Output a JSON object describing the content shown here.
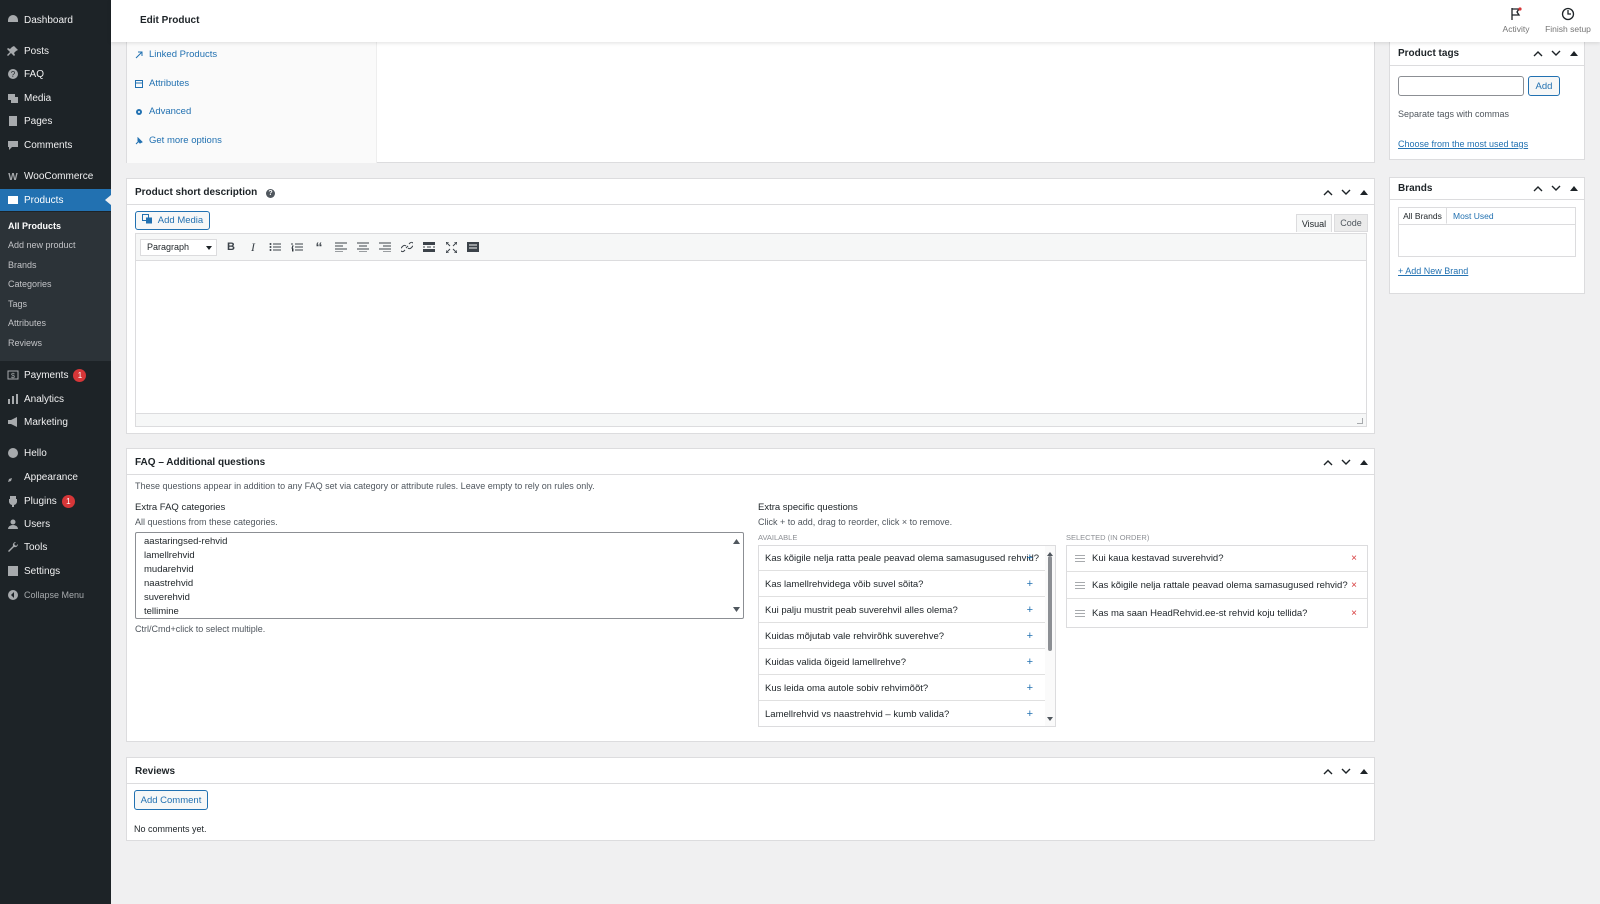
{
  "sidebar": {
    "menu": [
      {
        "label": "Dashboard",
        "icon": "dashboard-icon"
      },
      {
        "label": "Posts",
        "icon": "pin-icon"
      },
      {
        "label": "FAQ",
        "icon": "question-icon"
      },
      {
        "label": "Media",
        "icon": "media-icon"
      },
      {
        "label": "Pages",
        "icon": "page-icon"
      },
      {
        "label": "Comments",
        "icon": "comment-icon"
      },
      {
        "label": "WooCommerce",
        "icon": "woo-icon"
      },
      {
        "label": "Products",
        "icon": "archive-icon"
      },
      {
        "label": "Payments",
        "icon": "payments-icon",
        "badge": "1"
      },
      {
        "label": "Analytics",
        "icon": "bar-chart-icon"
      },
      {
        "label": "Marketing",
        "icon": "megaphone-icon"
      },
      {
        "label": "Hello",
        "icon": "plus-circle-icon"
      },
      {
        "label": "Appearance",
        "icon": "brush-icon"
      },
      {
        "label": "Plugins",
        "icon": "plug-icon",
        "badge": "1"
      },
      {
        "label": "Users",
        "icon": "users-icon"
      },
      {
        "label": "Tools",
        "icon": "wrench-icon"
      },
      {
        "label": "Settings",
        "icon": "settings-icon"
      },
      {
        "label": "Collapse Menu",
        "icon": "collapse-icon"
      }
    ],
    "submenu": [
      "All Products",
      "Add new product",
      "Brands",
      "Categories",
      "Tags",
      "Attributes",
      "Reviews"
    ]
  },
  "topbar": {
    "title": "Edit Product",
    "activity": "Activity",
    "finish_setup": "Finish setup"
  },
  "product_data": {
    "tabs": [
      "Linked Products",
      "Attributes",
      "Advanced",
      "Get more options"
    ]
  },
  "short_desc": {
    "title": "Product short description",
    "add_media": "Add Media",
    "visual": "Visual",
    "code": "Code",
    "format": "Paragraph"
  },
  "faq": {
    "title": "FAQ – Additional questions",
    "intro": "These questions appear in addition to any FAQ set via category or attribute rules. Leave empty to rely on rules only.",
    "cat_label": "Extra FAQ categories",
    "cat_hint": "All questions from these categories.",
    "categories": [
      "aastaringsed-rehvid",
      "lamellrehvid",
      "mudarehvid",
      "naastrehvid",
      "suverehvid",
      "tellimine"
    ],
    "cat_note": "Ctrl/Cmd+click to select multiple.",
    "spec_label": "Extra specific questions",
    "spec_hint": "Click + to add, drag to reorder, click × to remove.",
    "available_label": "AVAILABLE",
    "selected_label": "SELECTED (IN ORDER)",
    "available": [
      "Kas kõigile nelja ratta peale peavad olema samasugused rehvid?",
      "Kas lamellrehvidega võib suvel sõita?",
      "Kui palju mustrit peab suverehvil alles olema?",
      "Kuidas mõjutab vale rehvirõhk suverehve?",
      "Kuidas valida õigeid lamellrehve?",
      "Kus leida oma autole sobiv rehvimõõt?",
      "Lamellrehvid vs naastrehvid – kumb valida?"
    ],
    "selected": [
      "Kui kaua kestavad suverehvid?",
      "Kas kõigile nelja rattale peavad olema samasugused rehvid?",
      "Kas ma saan HeadRehvid.ee-st rehvid koju tellida?"
    ],
    "plus": "+",
    "remove": "×"
  },
  "reviews": {
    "title": "Reviews",
    "add_comment": "Add Comment",
    "empty": "No comments yet."
  },
  "tags": {
    "title": "Product tags",
    "add": "Add",
    "hint": "Separate tags with commas",
    "choose": "Choose from the most used tags",
    "input_value": ""
  },
  "brands": {
    "title": "Brands",
    "tab_all": "All Brands",
    "tab_most": "Most Used",
    "add_new": "+ Add New Brand"
  },
  "colors": {
    "accent": "#2271b1",
    "sidebar": "#1d2327",
    "badge": "#d63638"
  }
}
